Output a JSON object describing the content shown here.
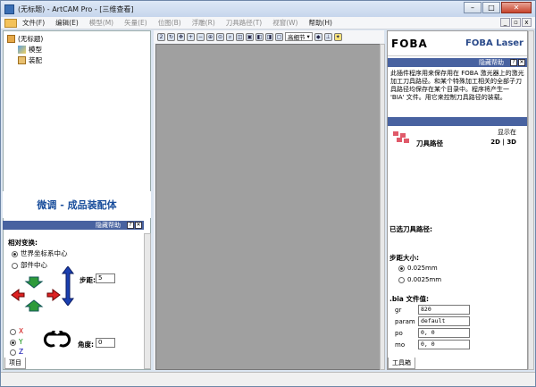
{
  "window": {
    "title": "(无标题) - ArtCAM Pro - [三维查看]",
    "buttons": [
      "–",
      "□",
      "✕"
    ]
  },
  "menu": [
    {
      "label": "文件(F)",
      "enabled": true
    },
    {
      "label": "编辑(E)",
      "enabled": true
    },
    {
      "label": "模型(M)",
      "enabled": false
    },
    {
      "label": "矢量(E)",
      "enabled": false
    },
    {
      "label": "位图(B)",
      "enabled": false
    },
    {
      "label": "浮雕(R)",
      "enabled": false
    },
    {
      "label": "刀具路径(T)",
      "enabled": false
    },
    {
      "label": "视窗(W)",
      "enabled": false
    },
    {
      "label": "帮助(H)",
      "enabled": true
    }
  ],
  "tree": {
    "root": "(无标题)",
    "items": [
      "模型",
      "装配"
    ]
  },
  "left_panel": {
    "title": "微调 - 成品装配体",
    "help_label": "隐藏帮助",
    "section": "相对变换:",
    "options": [
      "世界坐标系中心",
      "部件中心"
    ],
    "step_label": "步距:",
    "step_value": "5",
    "axes": [
      "X",
      "Y",
      "Z"
    ],
    "angle_label": "角度:",
    "angle_value": "0",
    "tab": "项目"
  },
  "toolbar": {
    "select_value": "高细节"
  },
  "right_panel": {
    "logo": "FOBA",
    "product": "FOBA Laser",
    "help_label": "隐藏帮助",
    "description": "此插件程序用来保存用在 FOBA 激光器上的激光加工刀具路径。和某个特殊加工相关的全部子刀具路径均保存在某个目录中。程序将产生一 'BIA' 文件。用它来控制刀具路径的装载。",
    "toolpath_label": "刀具路径",
    "display_label": "显示在",
    "display_value": "2D | 3D",
    "selected_label": "已选刀具路径:",
    "step_label": "步距大小:",
    "step_options": [
      "0.025mm",
      "0.0025mm"
    ],
    "bia_label": ".bia 文件值:",
    "fields": [
      {
        "key": "gr",
        "value": "820"
      },
      {
        "key": "param",
        "value": "default"
      },
      {
        "key": "po",
        "value": "0, 0"
      },
      {
        "key": "mo",
        "value": "0, 0"
      }
    ],
    "tab": "工具箱"
  }
}
